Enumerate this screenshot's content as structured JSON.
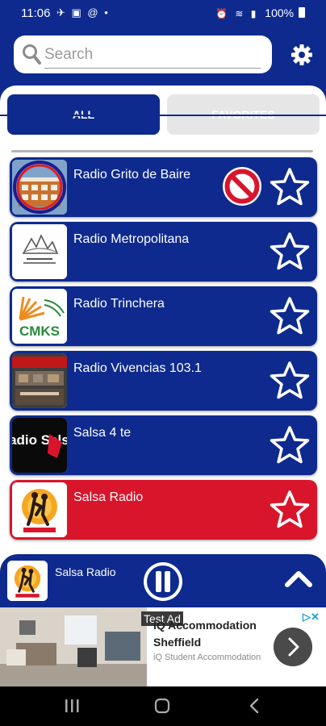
{
  "status_bar": {
    "time": "11:06",
    "left_icons": "✈ ▣ @ •",
    "right_icons": "⏰ ≋ ▮",
    "battery": "100%"
  },
  "search": {
    "placeholder": "Search"
  },
  "tabs": [
    {
      "label": "ALL",
      "selected": true
    },
    {
      "label": "FAVORITES",
      "selected": false
    }
  ],
  "stations": [
    {
      "name": "Radio Grito de Baire",
      "logo": "grito-logo",
      "blocked_icon": true,
      "favorite": false,
      "active": false
    },
    {
      "name": "Radio Metropolitana",
      "logo": "metropolitana-logo",
      "favorite": false,
      "active": false
    },
    {
      "name": "Radio Trinchera",
      "logo": "cmks-logo",
      "logo_text": "CMKS",
      "favorite": false,
      "active": false
    },
    {
      "name": "Radio Vivencias 103.1",
      "logo": "vivencias-logo",
      "favorite": false,
      "active": false
    },
    {
      "name": "Salsa 4 te",
      "logo": "radio-salsa-logo",
      "logo_text": "Radio Salsa",
      "favorite": false,
      "active": false
    },
    {
      "name": "Salsa Radio",
      "logo": "salsa-dancers-logo",
      "favorite": false,
      "active": true
    }
  ],
  "player": {
    "station_name": "Salsa Radio",
    "state": "playing"
  },
  "ad": {
    "label": "Test Ad",
    "title": "iQ Accommodation Sheffield",
    "subtitle": "iQ Student Accommodation"
  },
  "colors": {
    "primary": "#0e2a8e",
    "active": "#d8152b",
    "tab_inactive": "#e6e6e6"
  }
}
